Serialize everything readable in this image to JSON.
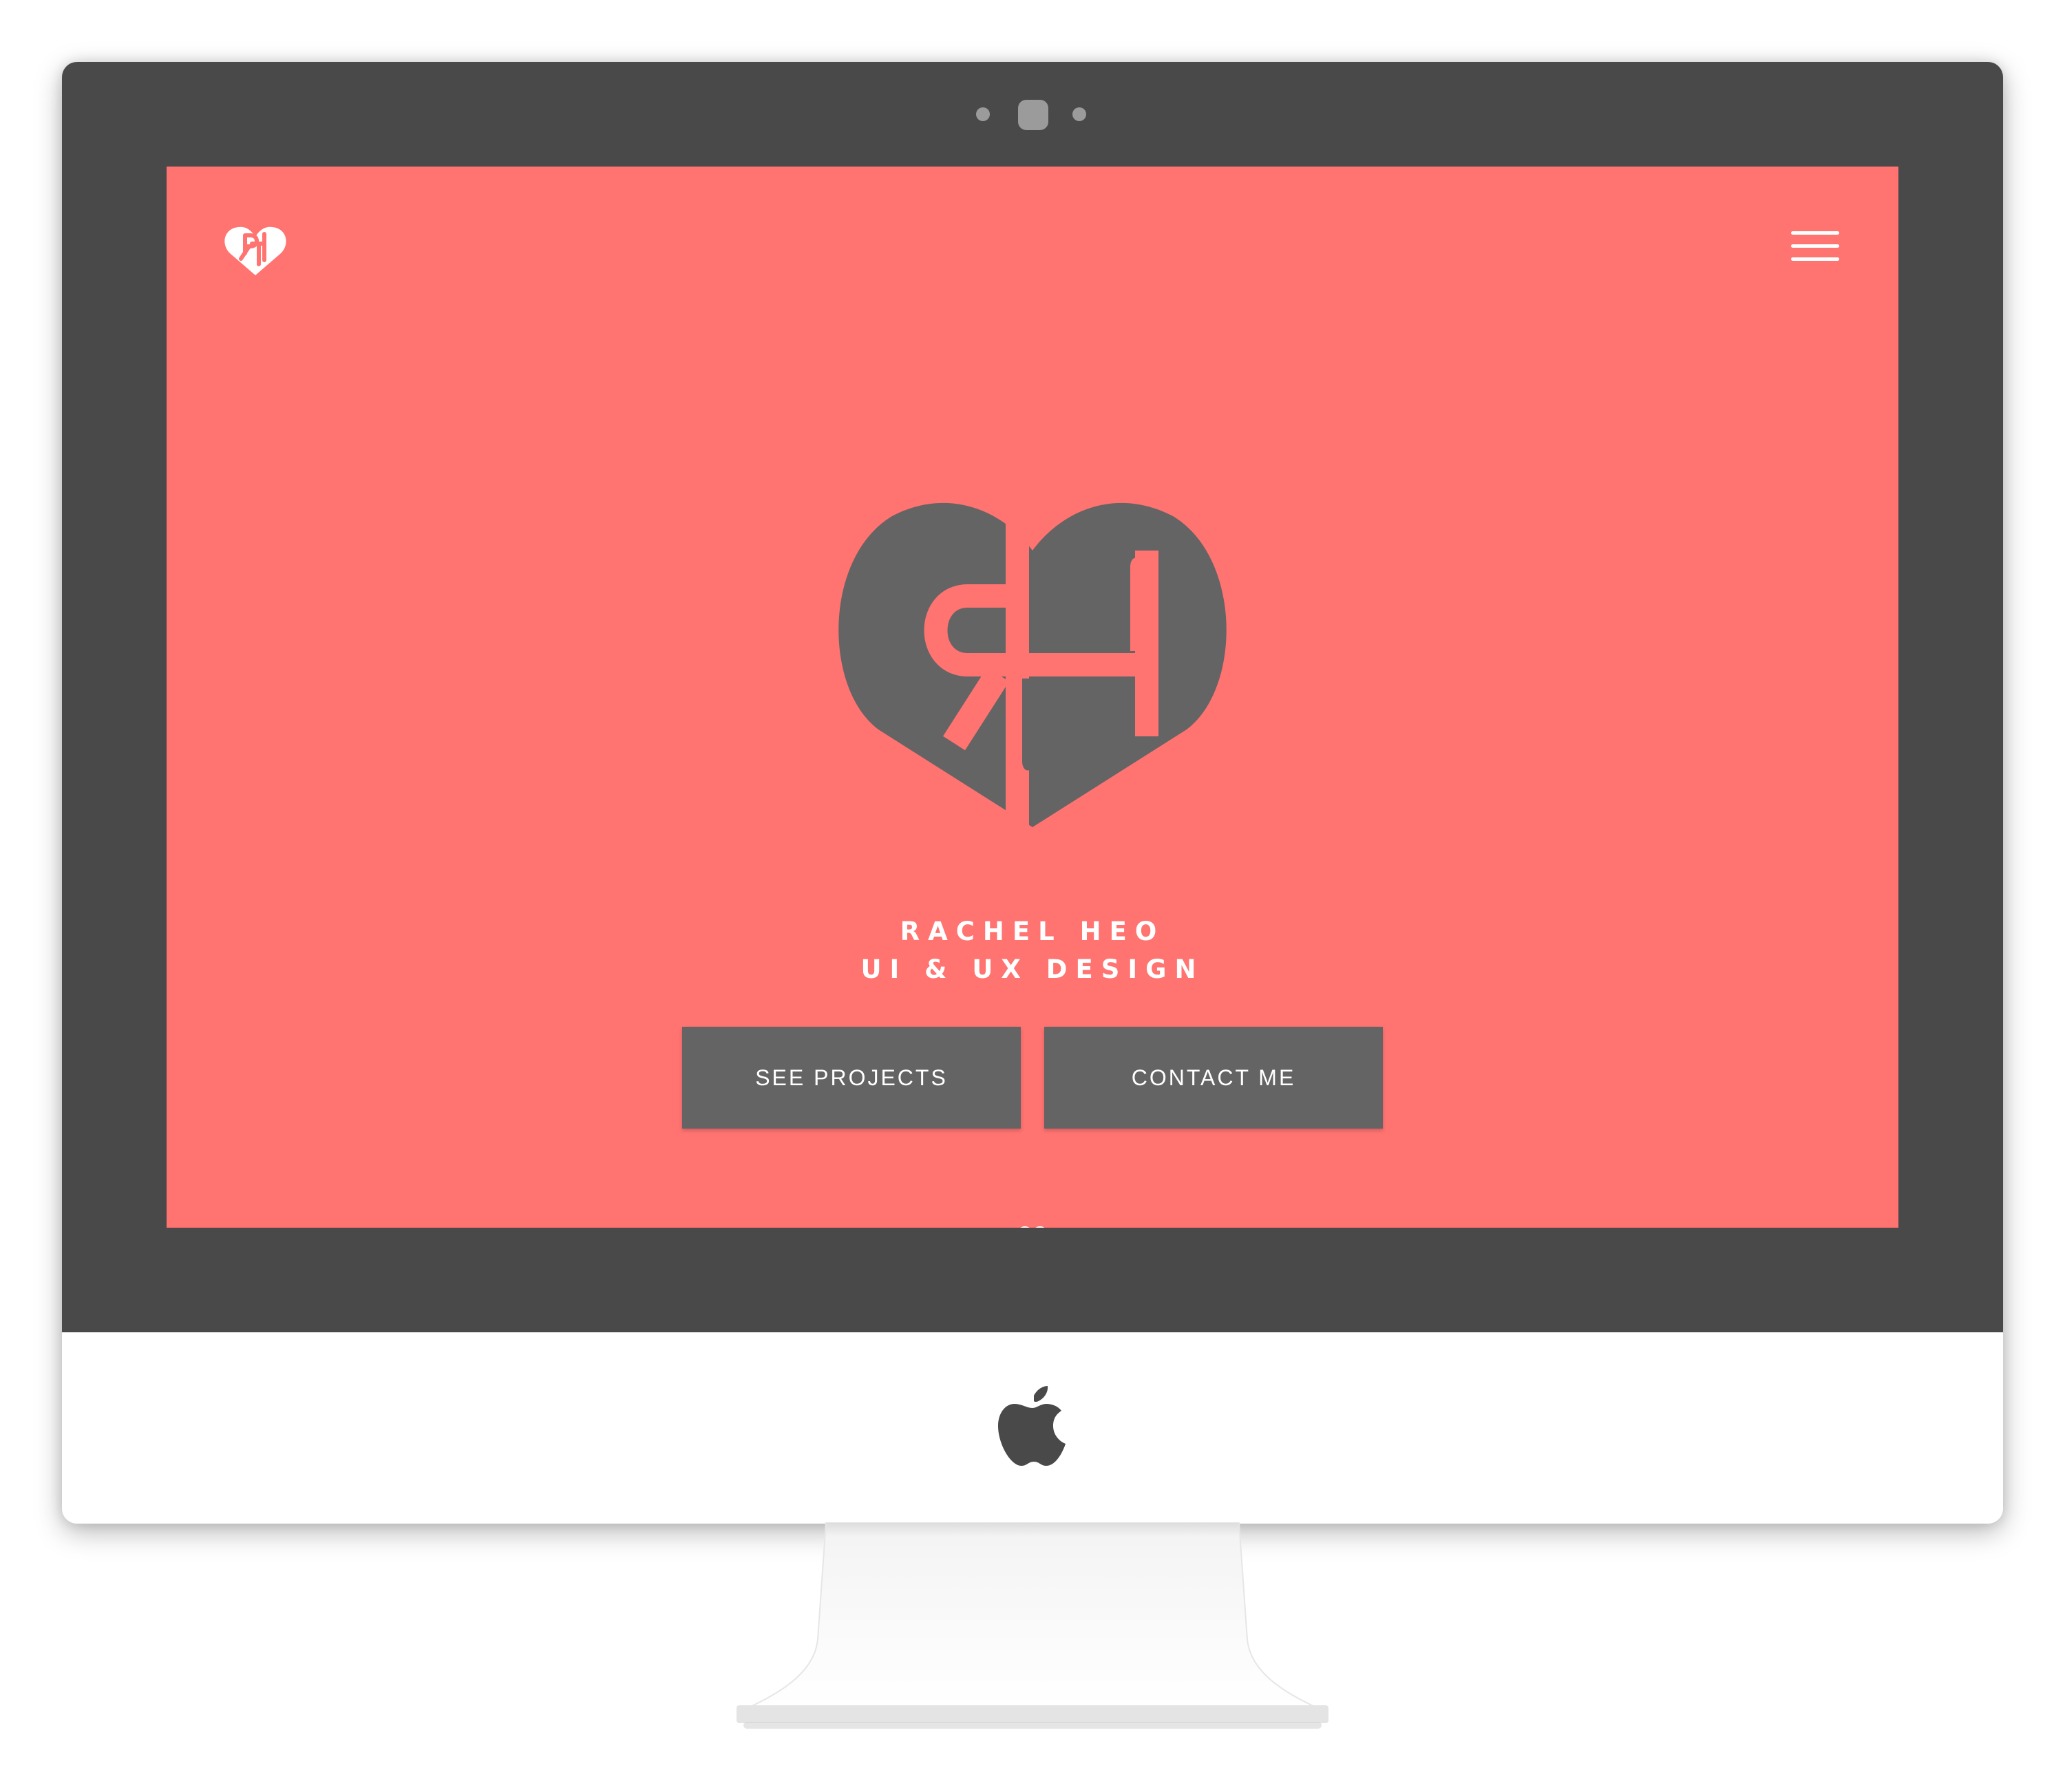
{
  "hero": {
    "name": "RACHEL HEO",
    "tagline": "UI & UX DESIGN"
  },
  "actions": {
    "projects_label": "SEE PROJECTS",
    "contact_label": "CONTACT ME"
  },
  "icons": {
    "site_logo": "rh-heart-monogram-icon",
    "menu": "hamburger-menu-icon",
    "scroll": "heart-arrow-down-icon",
    "device_brand": "apple-logo-icon"
  },
  "colors": {
    "screen_background": "#ff7371",
    "logo_gray": "#646464",
    "button_background": "#646464",
    "text": "#ffffff",
    "bezel": "#494949"
  }
}
